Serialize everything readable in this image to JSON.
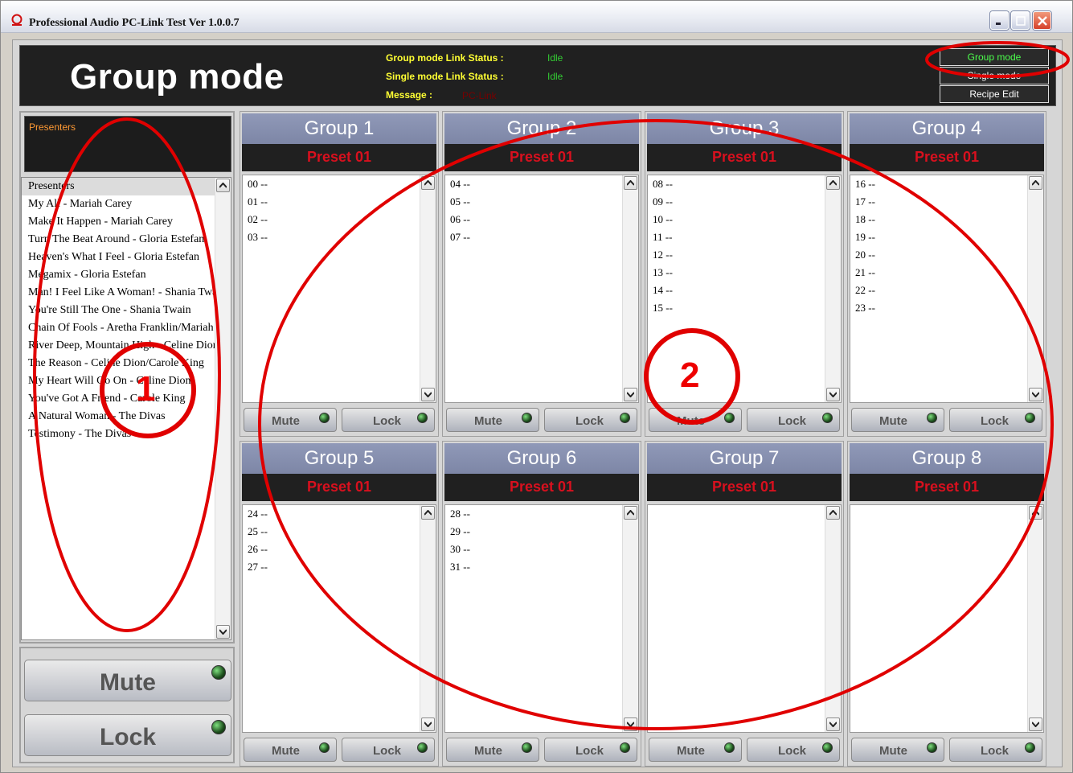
{
  "window": {
    "title": "Professional Audio PC-Link  Test Ver 1.0.0.7"
  },
  "header": {
    "title": "Group mode",
    "group_status_label": "Group mode Link Status :",
    "group_status_value": "Idle",
    "single_status_label": "Single mode Link Status :",
    "single_status_value": "Idle",
    "message_label": "Message :",
    "message_value": "PC-Link"
  },
  "modes": [
    "Group mode",
    "Single mode",
    "Recipe Edit"
  ],
  "presenters": {
    "title": "Presenters",
    "items": [
      "Presenters",
      "My All - Mariah Carey",
      "Make It Happen - Mariah Carey",
      "Turn The Beat Around - Gloria Estefan",
      "Heaven's What I Feel - Gloria Estefan",
      "Megamix - Gloria Estefan",
      "Man! I Feel Like A Woman! - Shania Twain",
      "You're Still The One - Shania Twain",
      "Chain Of Fools - Aretha Franklin/Mariah Carey",
      "River Deep, Mountain High - Celine Dion",
      "The Reason - Celine Dion/Carole King",
      "My Heart Will Go On - Celine Dion",
      "You've Got A Friend - Carole King",
      "A Natural Woman - The Divas",
      "Testimony - The Divas"
    ]
  },
  "left_controls": {
    "mute_label": "Mute",
    "lock_label": "Lock"
  },
  "groups": [
    {
      "title": "Group 1",
      "preset": "Preset 01",
      "channels": [
        "00 --",
        "01 --",
        "02 --",
        "03 --"
      ],
      "mute": "Mute",
      "lock": "Lock"
    },
    {
      "title": "Group 2",
      "preset": "Preset 01",
      "channels": [
        "04 --",
        "05 --",
        "06 --",
        "07 --"
      ],
      "mute": "Mute",
      "lock": "Lock"
    },
    {
      "title": "Group 3",
      "preset": "Preset 01",
      "channels": [
        "08 --",
        "09 --",
        "10 --",
        "11 --",
        "12 --",
        "13 --",
        "14 --",
        "15 --"
      ],
      "mute": "Mute",
      "lock": "Lock"
    },
    {
      "title": "Group 4",
      "preset": "Preset 01",
      "channels": [
        "16 --",
        "17 --",
        "18 --",
        "19 --",
        "20 --",
        "21 --",
        "22 --",
        "23 --"
      ],
      "mute": "Mute",
      "lock": "Lock"
    },
    {
      "title": "Group 5",
      "preset": "Preset 01",
      "channels": [
        "24 --",
        "25 --",
        "26 --",
        "27 --"
      ],
      "mute": "Mute",
      "lock": "Lock"
    },
    {
      "title": "Group 6",
      "preset": "Preset 01",
      "channels": [
        "28 --",
        "29 --",
        "30 --",
        "31 --"
      ],
      "mute": "Mute",
      "lock": "Lock"
    },
    {
      "title": "Group 7",
      "preset": "Preset 01",
      "channels": [],
      "mute": "Mute",
      "lock": "Lock"
    },
    {
      "title": "Group 8",
      "preset": "Preset 01",
      "channels": [],
      "mute": "Mute",
      "lock": "Lock"
    }
  ],
  "annotations": {
    "one": "1",
    "two": "2"
  },
  "colors": {
    "annotation": "#e00000",
    "preset_text": "#d8101e",
    "status_label": "#ffff33",
    "status_value": "#33cc33",
    "presenters_title": "#ff9933"
  }
}
